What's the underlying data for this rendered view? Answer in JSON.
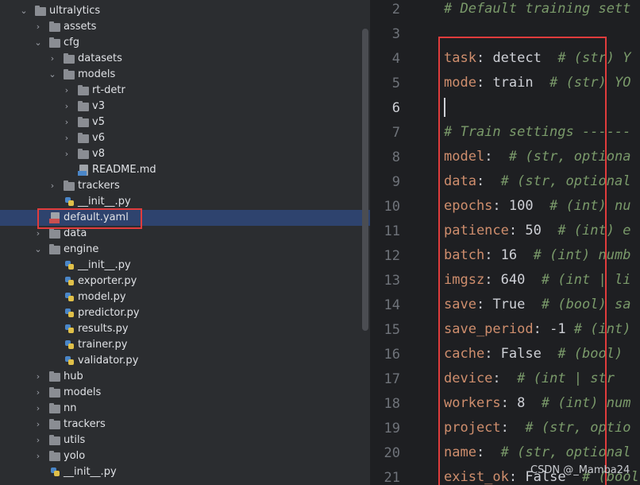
{
  "tree": {
    "rows": [
      {
        "label": "ultralytics",
        "type": "folder",
        "expanded": true
      },
      {
        "label": "assets",
        "type": "folder",
        "expanded": false
      },
      {
        "label": "cfg",
        "type": "folder",
        "expanded": true
      },
      {
        "label": "datasets",
        "type": "folder",
        "expanded": false
      },
      {
        "label": "models",
        "type": "folder",
        "expanded": true
      },
      {
        "label": "rt-detr",
        "type": "folder",
        "expanded": false
      },
      {
        "label": "v3",
        "type": "folder",
        "expanded": false
      },
      {
        "label": "v5",
        "type": "folder",
        "expanded": false
      },
      {
        "label": "v6",
        "type": "folder",
        "expanded": false
      },
      {
        "label": "v8",
        "type": "folder",
        "expanded": false
      },
      {
        "label": "README.md",
        "type": "md"
      },
      {
        "label": "trackers",
        "type": "folder",
        "expanded": false
      },
      {
        "label": "__init__.py",
        "type": "py"
      },
      {
        "label": "default.yaml",
        "type": "yaml",
        "selected": true
      },
      {
        "label": "data",
        "type": "folder",
        "expanded": false
      },
      {
        "label": "engine",
        "type": "folder",
        "expanded": true
      },
      {
        "label": "__init__.py",
        "type": "py"
      },
      {
        "label": "exporter.py",
        "type": "py"
      },
      {
        "label": "model.py",
        "type": "py"
      },
      {
        "label": "predictor.py",
        "type": "py"
      },
      {
        "label": "results.py",
        "type": "py"
      },
      {
        "label": "trainer.py",
        "type": "py"
      },
      {
        "label": "validator.py",
        "type": "py"
      },
      {
        "label": "hub",
        "type": "folder",
        "expanded": false
      },
      {
        "label": "models",
        "type": "folder",
        "expanded": false
      },
      {
        "label": "nn",
        "type": "folder",
        "expanded": false
      },
      {
        "label": "trackers",
        "type": "folder",
        "expanded": false
      },
      {
        "label": "utils",
        "type": "folder",
        "expanded": false
      },
      {
        "label": "yolo",
        "type": "folder",
        "expanded": false
      },
      {
        "label": "__init__.py",
        "type": "py"
      }
    ]
  },
  "editor": {
    "current_line": 6,
    "lines": [
      {
        "n": "2",
        "k": "",
        "sep": "",
        "v": "",
        "c": "# Default training sett"
      },
      {
        "n": "3",
        "k": "",
        "sep": "",
        "v": "",
        "c": ""
      },
      {
        "n": "4",
        "k": "task",
        "sep": ": ",
        "v": "detect  ",
        "c": "# (str) Y"
      },
      {
        "n": "5",
        "k": "mode",
        "sep": ": ",
        "v": "train  ",
        "c": "# (str) YO"
      },
      {
        "n": "6",
        "k": "",
        "sep": "",
        "v": "",
        "c": ""
      },
      {
        "n": "7",
        "k": "",
        "sep": "",
        "v": "",
        "c": "# Train settings ------"
      },
      {
        "n": "8",
        "k": "model",
        "sep": ":  ",
        "v": "",
        "c": "# (str, optiona"
      },
      {
        "n": "9",
        "k": "data",
        "sep": ":  ",
        "v": "",
        "c": "# (str, optional"
      },
      {
        "n": "10",
        "k": "epochs",
        "sep": ": ",
        "v": "100  ",
        "c": "# (int) nu"
      },
      {
        "n": "11",
        "k": "patience",
        "sep": ": ",
        "v": "50  ",
        "c": "# (int) e"
      },
      {
        "n": "12",
        "k": "batch",
        "sep": ": ",
        "v": "16  ",
        "c": "# (int) numb"
      },
      {
        "n": "13",
        "k": "imgsz",
        "sep": ": ",
        "v": "640  ",
        "c": "# (int | li"
      },
      {
        "n": "14",
        "k": "save",
        "sep": ": ",
        "v": "True  ",
        "c": "# (bool) sa"
      },
      {
        "n": "15",
        "k": "save_period",
        "sep": ": ",
        "v": "-1 ",
        "c": "# (int)"
      },
      {
        "n": "16",
        "k": "cache",
        "sep": ": ",
        "v": "False  ",
        "c": "# (bool)"
      },
      {
        "n": "17",
        "k": "device",
        "sep": ":  ",
        "v": "",
        "c": "# (int | str"
      },
      {
        "n": "18",
        "k": "workers",
        "sep": ": ",
        "v": "8  ",
        "c": "# (int) num"
      },
      {
        "n": "19",
        "k": "project",
        "sep": ":  ",
        "v": "",
        "c": "# (str, optio"
      },
      {
        "n": "20",
        "k": "name",
        "sep": ":  ",
        "v": "",
        "c": "# (str, optional"
      },
      {
        "n": "21",
        "k": "exist_ok",
        "sep": ": ",
        "v": "False  ",
        "c": "# (bool"
      }
    ]
  },
  "watermark": "CSDN @_Mamba24",
  "colors": {
    "tree_bg": "#2b2d30",
    "editor_bg": "#1e1f22",
    "selection": "#2e436e",
    "highlight_box": "#e03c3c",
    "key": "#cf8e6d",
    "comment": "#7a9a6a"
  }
}
